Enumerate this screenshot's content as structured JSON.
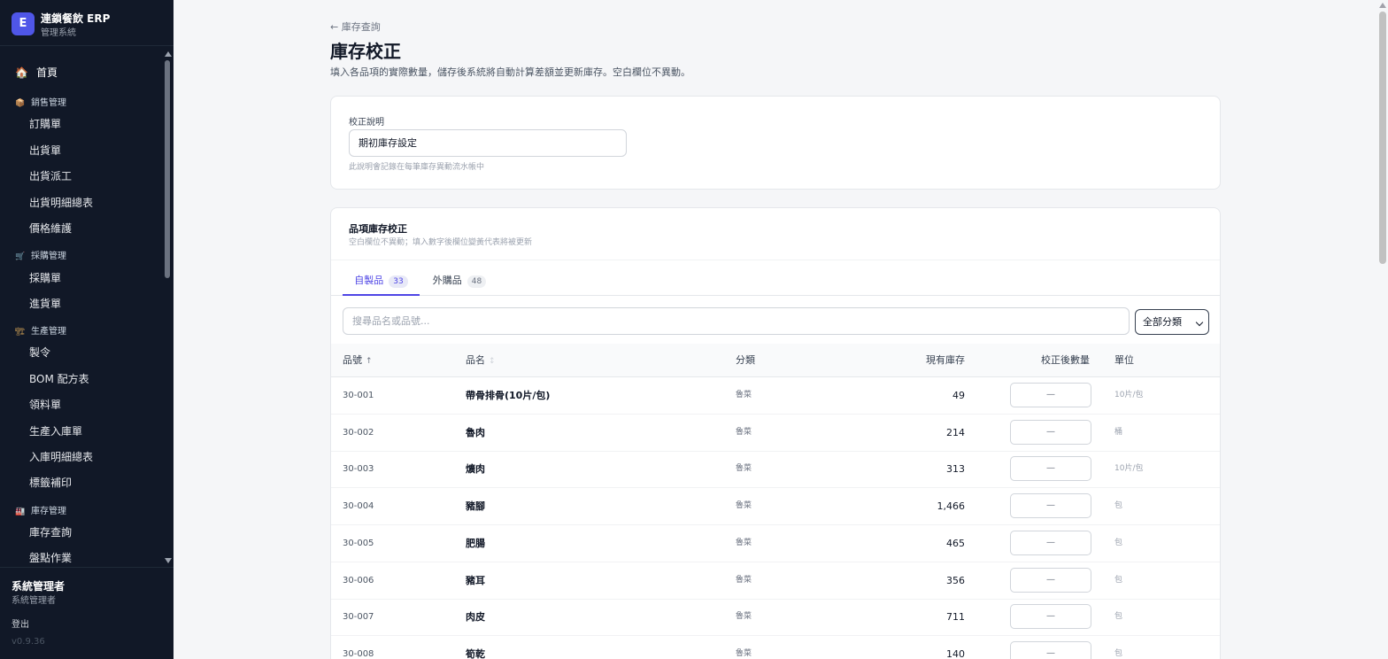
{
  "brand": {
    "logo": "E",
    "title": "連鎖餐飲 ERP",
    "subtitle": "管理系統"
  },
  "nav": {
    "home": {
      "icon": "🏠",
      "label": "首頁"
    },
    "groups": [
      {
        "icon": "📦",
        "label": "銷售管理",
        "items": [
          "訂購單",
          "出貨單",
          "出貨派工",
          "出貨明細總表",
          "價格維護"
        ]
      },
      {
        "icon": "🛒",
        "label": "採購管理",
        "items": [
          "採購單",
          "進貨單"
        ]
      },
      {
        "icon": "🏗",
        "label": "生產管理",
        "items": [
          "製令",
          "BOM 配方表",
          "領料單",
          "生產入庫單",
          "入庫明細總表",
          "標籤補印"
        ]
      },
      {
        "icon": "🏭",
        "label": "庫存管理",
        "items": [
          "庫存查詢",
          "盤點作業"
        ]
      }
    ]
  },
  "user": {
    "name": "系統管理者",
    "role": "系統管理者",
    "logout": "登出",
    "version": "v0.9.36"
  },
  "page": {
    "back": "← 庫存查詢",
    "title": "庫存校正",
    "desc": "填入各品項的實際數量，儲存後系統將自動計算差額並更新庫存。空白欄位不異動。"
  },
  "note": {
    "label": "校正說明",
    "value": "期初庫存設定",
    "help": "此說明會記錄在每筆庫存異動流水帳中"
  },
  "section": {
    "title": "品項庫存校正",
    "subtitle": "空白欄位不異動；填入數字後欄位變黃代表將被更新"
  },
  "tabs": [
    {
      "label": "自製品",
      "count": "33"
    },
    {
      "label": "外購品",
      "count": "48"
    }
  ],
  "search": {
    "placeholder": "搜尋品名或品號..."
  },
  "filter": {
    "selected": "全部分類"
  },
  "table": {
    "headers": {
      "code": "品號",
      "code_sort": "↑",
      "name": "品名",
      "name_sort": "↕",
      "category": "分類",
      "stock": "現有庫存",
      "adjusted": "校正後數量",
      "unit": "單位"
    },
    "input_placeholder": "—",
    "rows": [
      {
        "code": "30-001",
        "name": "帶骨排骨(10片/包)",
        "category": "魯菜",
        "stock": "49",
        "unit": "10片/包"
      },
      {
        "code": "30-002",
        "name": "魯肉",
        "category": "魯菜",
        "stock": "214",
        "unit": "桶"
      },
      {
        "code": "30-003",
        "name": "爌肉",
        "category": "魯菜",
        "stock": "313",
        "unit": "10片/包"
      },
      {
        "code": "30-004",
        "name": "豬腳",
        "category": "魯菜",
        "stock": "1,466",
        "unit": "包"
      },
      {
        "code": "30-005",
        "name": "肥腸",
        "category": "魯菜",
        "stock": "465",
        "unit": "包"
      },
      {
        "code": "30-006",
        "name": "豬耳",
        "category": "魯菜",
        "stock": "356",
        "unit": "包"
      },
      {
        "code": "30-007",
        "name": "肉皮",
        "category": "魯菜",
        "stock": "711",
        "unit": "包"
      },
      {
        "code": "30-008",
        "name": "筍乾",
        "category": "魯菜",
        "stock": "140",
        "unit": "包"
      }
    ]
  }
}
